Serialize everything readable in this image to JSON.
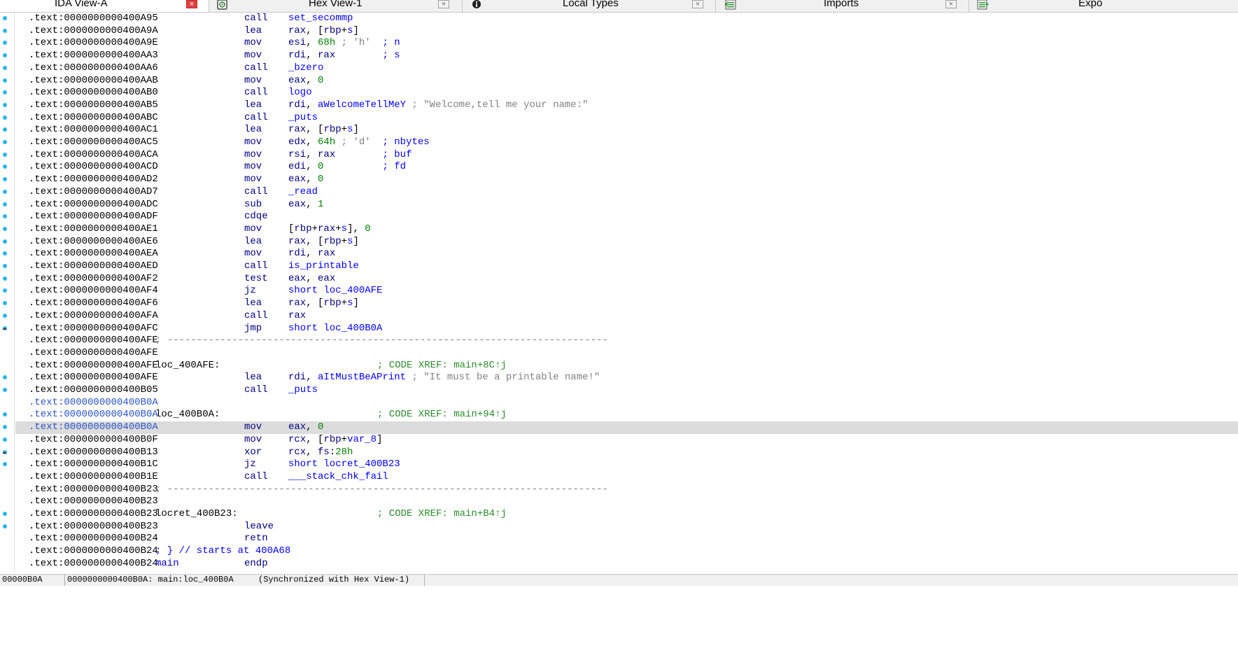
{
  "tabs": [
    {
      "label": "IDA View-A",
      "active": true,
      "icon": "ida-view-icon"
    },
    {
      "label": "Hex View-1",
      "active": false,
      "icon": "hex-view-icon"
    },
    {
      "label": "Local Types",
      "active": false,
      "icon": "info-icon"
    },
    {
      "label": "Imports",
      "active": false,
      "icon": "imports-icon"
    },
    {
      "label": "Expo",
      "active": false,
      "icon": "exports-icon"
    }
  ],
  "rows": [
    {
      "addr": ".text:0000000000400A95",
      "mn": "call",
      "op": [
        {
          "t": "set_secommp",
          "c": "sym"
        }
      ]
    },
    {
      "addr": ".text:0000000000400A9A",
      "mn": "lea",
      "op": [
        {
          "t": "rax",
          "c": "reg"
        },
        {
          "t": ", [",
          "c": ""
        },
        {
          "t": "rbp",
          "c": "reg"
        },
        {
          "t": "+",
          "c": ""
        },
        {
          "t": "s",
          "c": "sym"
        },
        {
          "t": "]",
          "c": ""
        }
      ]
    },
    {
      "addr": ".text:0000000000400A9E",
      "mn": "mov",
      "op": [
        {
          "t": "esi",
          "c": "reg"
        },
        {
          "t": ", ",
          "c": ""
        },
        {
          "t": "68h",
          "c": "num"
        },
        {
          "t": " ; 'h'  ",
          "c": "str"
        },
        {
          "t": "; n",
          "c": "cmt"
        }
      ]
    },
    {
      "addr": ".text:0000000000400AA3",
      "mn": "mov",
      "op": [
        {
          "t": "rdi",
          "c": "reg"
        },
        {
          "t": ", ",
          "c": ""
        },
        {
          "t": "rax",
          "c": "reg"
        },
        {
          "t": "        ",
          "c": ""
        },
        {
          "t": "; s",
          "c": "cmt"
        }
      ]
    },
    {
      "addr": ".text:0000000000400AA6",
      "mn": "call",
      "op": [
        {
          "t": "_bzero",
          "c": "sym"
        }
      ]
    },
    {
      "addr": ".text:0000000000400AAB",
      "mn": "mov",
      "op": [
        {
          "t": "eax",
          "c": "reg"
        },
        {
          "t": ", ",
          "c": ""
        },
        {
          "t": "0",
          "c": "num"
        }
      ]
    },
    {
      "addr": ".text:0000000000400AB0",
      "mn": "call",
      "op": [
        {
          "t": "logo",
          "c": "sym"
        }
      ]
    },
    {
      "addr": ".text:0000000000400AB5",
      "mn": "lea",
      "op": [
        {
          "t": "rdi",
          "c": "reg"
        },
        {
          "t": ", ",
          "c": ""
        },
        {
          "t": "aWelcomeTellMeY",
          "c": "sym"
        },
        {
          "t": " ; \"Welcome,tell me your name:\"",
          "c": "str"
        }
      ]
    },
    {
      "addr": ".text:0000000000400ABC",
      "mn": "call",
      "op": [
        {
          "t": "_puts",
          "c": "sym"
        }
      ]
    },
    {
      "addr": ".text:0000000000400AC1",
      "mn": "lea",
      "op": [
        {
          "t": "rax",
          "c": "reg"
        },
        {
          "t": ", [",
          "c": ""
        },
        {
          "t": "rbp",
          "c": "reg"
        },
        {
          "t": "+",
          "c": ""
        },
        {
          "t": "s",
          "c": "sym"
        },
        {
          "t": "]",
          "c": ""
        }
      ]
    },
    {
      "addr": ".text:0000000000400AC5",
      "mn": "mov",
      "op": [
        {
          "t": "edx",
          "c": "reg"
        },
        {
          "t": ", ",
          "c": ""
        },
        {
          "t": "64h",
          "c": "num"
        },
        {
          "t": " ; 'd'  ",
          "c": "str"
        },
        {
          "t": "; nbytes",
          "c": "cmt"
        }
      ]
    },
    {
      "addr": ".text:0000000000400ACA",
      "mn": "mov",
      "op": [
        {
          "t": "rsi",
          "c": "reg"
        },
        {
          "t": ", ",
          "c": ""
        },
        {
          "t": "rax",
          "c": "reg"
        },
        {
          "t": "        ",
          "c": ""
        },
        {
          "t": "; buf",
          "c": "cmt"
        }
      ]
    },
    {
      "addr": ".text:0000000000400ACD",
      "mn": "mov",
      "op": [
        {
          "t": "edi",
          "c": "reg"
        },
        {
          "t": ", ",
          "c": ""
        },
        {
          "t": "0",
          "c": "num"
        },
        {
          "t": "          ",
          "c": ""
        },
        {
          "t": "; fd",
          "c": "cmt"
        }
      ]
    },
    {
      "addr": ".text:0000000000400AD2",
      "mn": "mov",
      "op": [
        {
          "t": "eax",
          "c": "reg"
        },
        {
          "t": ", ",
          "c": ""
        },
        {
          "t": "0",
          "c": "num"
        }
      ]
    },
    {
      "addr": ".text:0000000000400AD7",
      "mn": "call",
      "op": [
        {
          "t": "_read",
          "c": "sym"
        }
      ]
    },
    {
      "addr": ".text:0000000000400ADC",
      "mn": "sub",
      "op": [
        {
          "t": "eax",
          "c": "reg"
        },
        {
          "t": ", ",
          "c": ""
        },
        {
          "t": "1",
          "c": "num"
        }
      ]
    },
    {
      "addr": ".text:0000000000400ADF",
      "mn": "cdqe",
      "op": []
    },
    {
      "addr": ".text:0000000000400AE1",
      "mn": "mov",
      "op": [
        {
          "t": "[",
          "c": ""
        },
        {
          "t": "rbp",
          "c": "reg"
        },
        {
          "t": "+",
          "c": ""
        },
        {
          "t": "rax",
          "c": "reg"
        },
        {
          "t": "+",
          "c": ""
        },
        {
          "t": "s",
          "c": "sym"
        },
        {
          "t": "], ",
          "c": ""
        },
        {
          "t": "0",
          "c": "num"
        }
      ]
    },
    {
      "addr": ".text:0000000000400AE6",
      "mn": "lea",
      "op": [
        {
          "t": "rax",
          "c": "reg"
        },
        {
          "t": ", [",
          "c": ""
        },
        {
          "t": "rbp",
          "c": "reg"
        },
        {
          "t": "+",
          "c": ""
        },
        {
          "t": "s",
          "c": "sym"
        },
        {
          "t": "]",
          "c": ""
        }
      ]
    },
    {
      "addr": ".text:0000000000400AEA",
      "mn": "mov",
      "op": [
        {
          "t": "rdi",
          "c": "reg"
        },
        {
          "t": ", ",
          "c": ""
        },
        {
          "t": "rax",
          "c": "reg"
        }
      ]
    },
    {
      "addr": ".text:0000000000400AED",
      "mn": "call",
      "op": [
        {
          "t": "is_printable",
          "c": "sym"
        }
      ]
    },
    {
      "addr": ".text:0000000000400AF2",
      "mn": "test",
      "op": [
        {
          "t": "eax",
          "c": "reg"
        },
        {
          "t": ", ",
          "c": ""
        },
        {
          "t": "eax",
          "c": "reg"
        }
      ]
    },
    {
      "addr": ".text:0000000000400AF4",
      "mn": "jz",
      "op": [
        {
          "t": "short loc_400AFE",
          "c": "sym"
        }
      ]
    },
    {
      "addr": ".text:0000000000400AF6",
      "mn": "lea",
      "op": [
        {
          "t": "rax",
          "c": "reg"
        },
        {
          "t": ", [",
          "c": ""
        },
        {
          "t": "rbp",
          "c": "reg"
        },
        {
          "t": "+",
          "c": ""
        },
        {
          "t": "s",
          "c": "sym"
        },
        {
          "t": "]",
          "c": ""
        }
      ]
    },
    {
      "addr": ".text:0000000000400AFA",
      "mn": "call",
      "op": [
        {
          "t": "rax",
          "c": "reg"
        }
      ]
    },
    {
      "addr": ".text:0000000000400AFC",
      "mn": "jmp",
      "op": [
        {
          "t": "short loc_400B0A",
          "c": "sym"
        }
      ]
    },
    {
      "addr": ".text:0000000000400AFE",
      "sep": "; ---------------------------------------------------------------------------"
    },
    {
      "addr": ".text:0000000000400AFE"
    },
    {
      "addr": ".text:0000000000400AFE",
      "label": "loc_400AFE:",
      "xref": "; CODE XREF: main+8C↑j"
    },
    {
      "addr": ".text:0000000000400AFE",
      "mn": "lea",
      "op": [
        {
          "t": "rdi",
          "c": "reg"
        },
        {
          "t": ", ",
          "c": ""
        },
        {
          "t": "aItMustBeAPrint",
          "c": "sym"
        },
        {
          "t": " ; \"It must be a printable name!\"",
          "c": "str"
        }
      ]
    },
    {
      "addr": ".text:0000000000400B05",
      "mn": "call",
      "op": [
        {
          "t": "_puts",
          "c": "sym"
        }
      ]
    },
    {
      "addr": ".text:0000000000400B0A",
      "blue": true
    },
    {
      "addr": ".text:0000000000400B0A",
      "blue": true,
      "label": "loc_400B0A:",
      "xref": "; CODE XREF: main+94↑j"
    },
    {
      "addr": ".text:0000000000400B0A",
      "blue": true,
      "hl": true,
      "mn": "mov",
      "op": [
        {
          "t": "eax",
          "c": "reg"
        },
        {
          "t": ", ",
          "c": ""
        },
        {
          "t": "0",
          "c": "num"
        }
      ]
    },
    {
      "addr": ".text:0000000000400B0F",
      "mn": "mov",
      "op": [
        {
          "t": "rcx",
          "c": "reg"
        },
        {
          "t": ", [",
          "c": ""
        },
        {
          "t": "rbp",
          "c": "reg"
        },
        {
          "t": "+",
          "c": ""
        },
        {
          "t": "var_8",
          "c": "sym"
        },
        {
          "t": "]",
          "c": ""
        }
      ]
    },
    {
      "addr": ".text:0000000000400B13",
      "mn": "xor",
      "op": [
        {
          "t": "rcx",
          "c": "reg"
        },
        {
          "t": ", ",
          "c": ""
        },
        {
          "t": "fs",
          "c": "reg"
        },
        {
          "t": ":",
          "c": ""
        },
        {
          "t": "28h",
          "c": "num"
        }
      ]
    },
    {
      "addr": ".text:0000000000400B1C",
      "mn": "jz",
      "op": [
        {
          "t": "short locret_400B23",
          "c": "sym"
        }
      ]
    },
    {
      "addr": ".text:0000000000400B1E",
      "mn": "call",
      "op": [
        {
          "t": "___stack_chk_fail",
          "c": "sym"
        }
      ]
    },
    {
      "addr": ".text:0000000000400B23",
      "sep": "; ---------------------------------------------------------------------------"
    },
    {
      "addr": ".text:0000000000400B23"
    },
    {
      "addr": ".text:0000000000400B23",
      "label": "locret_400B23:",
      "xref": "; CODE XREF: main+B4↑j"
    },
    {
      "addr": ".text:0000000000400B23",
      "mn": "leave",
      "op": []
    },
    {
      "addr": ".text:0000000000400B24",
      "mn": "retn",
      "op": []
    },
    {
      "addr": ".text:0000000000400B24",
      "comment_line": "; } // starts at 400A68"
    },
    {
      "addr": ".text:0000000000400B24",
      "label": "main",
      "main": true,
      "mn": "endp",
      "op": []
    }
  ],
  "statusbar": {
    "offset": "00000B0A",
    "location": "0000000000400B0A: main:loc_400B0A",
    "sync": "(Synchronized with Hex View-1)"
  },
  "colors": {
    "gutter_dot": "#29b4ee",
    "active_close": "#e04343",
    "highlight_row": "#dcdcdc"
  }
}
